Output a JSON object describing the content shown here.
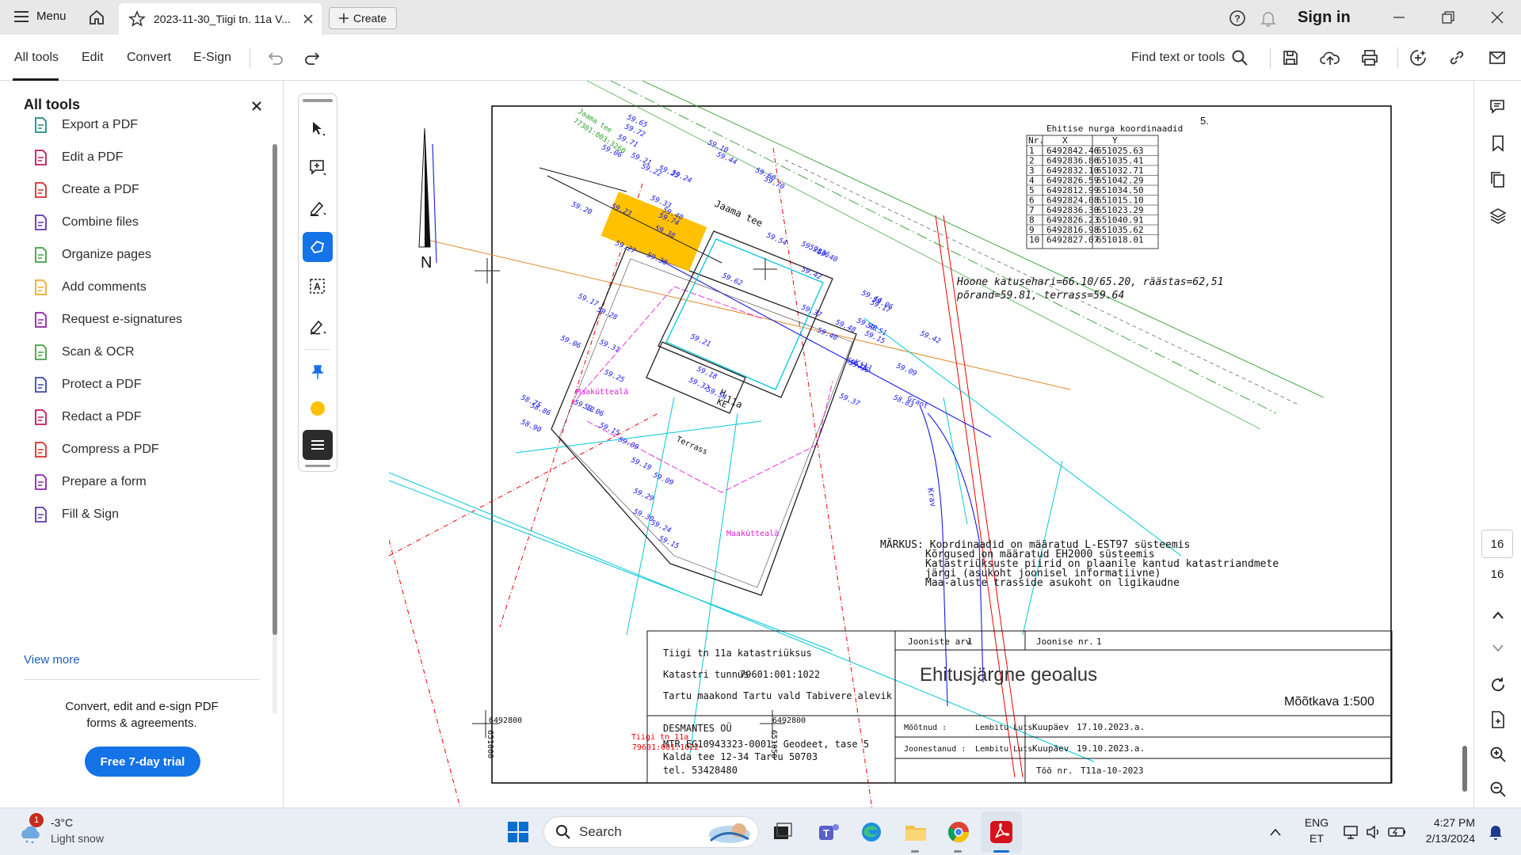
{
  "titlebar": {
    "menu_label": "Menu",
    "doc_tab_title": "2023-11-30_Tiigi tn. 11a V...",
    "create_label": "Create",
    "sign_in": "Sign in"
  },
  "toolbar": {
    "tabs": [
      "All tools",
      "Edit",
      "Convert",
      "E-Sign"
    ],
    "find_label": "Find text or tools"
  },
  "left_panel": {
    "title": "All tools",
    "items": [
      {
        "label": "Export a PDF",
        "icon": "export-pdf-icon",
        "color": "#1f8a8a"
      },
      {
        "label": "Edit a PDF",
        "icon": "edit-pdf-icon",
        "color": "#c2185b"
      },
      {
        "label": "Create a PDF",
        "icon": "create-pdf-icon",
        "color": "#d32f2f"
      },
      {
        "label": "Combine files",
        "icon": "combine-files-icon",
        "color": "#5e35b1"
      },
      {
        "label": "Organize pages",
        "icon": "organize-pages-icon",
        "color": "#43a047"
      },
      {
        "label": "Add comments",
        "icon": "add-comments-icon",
        "color": "#f9a825"
      },
      {
        "label": "Request e-signatures",
        "icon": "request-esign-icon",
        "color": "#8e24aa"
      },
      {
        "label": "Scan & OCR",
        "icon": "scan-ocr-icon",
        "color": "#43a047"
      },
      {
        "label": "Protect a PDF",
        "icon": "protect-pdf-icon",
        "color": "#3949ab"
      },
      {
        "label": "Redact a PDF",
        "icon": "redact-pdf-icon",
        "color": "#c2185b"
      },
      {
        "label": "Compress a PDF",
        "icon": "compress-pdf-icon",
        "color": "#d32f2f"
      },
      {
        "label": "Prepare a form",
        "icon": "prepare-form-icon",
        "color": "#8e24aa"
      },
      {
        "label": "Fill & Sign",
        "icon": "fill-sign-icon",
        "color": "#5e35b1"
      }
    ],
    "view_more": "View more",
    "promo_text_1": "Convert, edit and e-sign PDF",
    "promo_text_2": "forms & agreements.",
    "trial_button": "Free 7-day trial"
  },
  "drawing": {
    "page_number": "5.",
    "north": "N",
    "coord_table": {
      "title": "Ehitise nurga koordinaadid",
      "headers": [
        "Nr.",
        "X",
        "Y"
      ],
      "rows": [
        [
          "1",
          "6492842.46",
          "651025.63"
        ],
        [
          "2",
          "6492836.86",
          "651035.41"
        ],
        [
          "3",
          "6492832.10",
          "651032.71"
        ],
        [
          "4",
          "6492826.59",
          "651042.29"
        ],
        [
          "5",
          "6492812.99",
          "651034.50"
        ],
        [
          "6",
          "6492824.08",
          "651015.10"
        ],
        [
          "7",
          "6492836.30",
          "651023.29"
        ],
        [
          "8",
          "6492826.23",
          "651040.91"
        ],
        [
          "9",
          "6492816.98",
          "651035.62"
        ],
        [
          "10",
          "6492827.07",
          "651018.01"
        ]
      ]
    },
    "roof_note_1": "Hoone katusehari=66.10/65.20, räästas=62,51",
    "roof_note_2": "põrand=59.81, terrass=59.64",
    "markus": [
      "MÄRKUS: Koordinaadid on määratud L-EST97 süsteemis",
      "Kõrgused on määratud EH2000 süsteemis",
      "Katastriüksuste piirid on plaanile kantud katastriandmete",
      "järgi (asukoht joonisel informatiivne)",
      "Maa-aluste trasside asukoht on ligikaudne"
    ],
    "labels": {
      "jaama_tee": "Jaama tee",
      "jaama_tee_small": "Jaama tee",
      "jaama_tee_code": "77301:003:3260",
      "maakutteala": "Maaküttealã",
      "maakutteala2": "Maaküttealä",
      "terrass": "Terrass",
      "tiigi_tn": "Tiigi tn 11a",
      "tiigi_code": "79601:001:1022",
      "grid_x_left": "6492800",
      "grid_y_left": "651000",
      "grid_x_right": "6492800",
      "grid_y_right": "651050",
      "house_11a": "11a",
      "house_ke": "KE",
      "house_h": "H",
      "kill": "Kill",
      "krav": "Krav",
      "grant": "Grant"
    },
    "elevations": [
      "59.65",
      "59.72",
      "59.71",
      "59.06",
      "59.21",
      "59.22",
      "59.25",
      "59.24",
      "59.33",
      "59.40",
      "59.38",
      "59.23",
      "59.20",
      "59.27",
      "59.38",
      "59.17",
      "59.28",
      "59.31",
      "59.06",
      "59.25",
      "59.12",
      "59.06",
      "59.15",
      "59.09",
      "59.19",
      "59.09",
      "59.29",
      "59.30",
      "59.24",
      "59.15",
      "59.10",
      "59.44",
      "59.68",
      "59.70",
      "59.62",
      "59.54",
      "59.28",
      "59.36",
      "59.40",
      "59.42",
      "59.37",
      "59.40",
      "59.48",
      "59.44",
      "59.51",
      "59.40",
      "59.15",
      "59.23",
      "59.36",
      "59.42",
      "59.17",
      "59.06",
      "59.09",
      "58.83",
      "59.74",
      "58.75",
      "58.86",
      "58.90",
      "59.21",
      "59.18",
      "59.32",
      "59.54",
      "59.37"
    ],
    "title_block": {
      "parcel": "Tiigi tn 11a katastriüksus",
      "cadastral_label": "Katastri tunnus",
      "cadastral_value": "79601:001:1022",
      "location": "Tartu maakond Tartu vald Tabivere alevik",
      "company": "DESMANTES OÜ",
      "mtr": "MTR EG10943323-0001; Geodeet, tase 5",
      "address": "Kalda tee 12-34 Tartu 50703",
      "tel": "tel. 53428480",
      "sheets_label": "Jooniste arv",
      "sheets_value": "1",
      "sheet_no_label": "Joonise nr.",
      "sheet_no_value": "1",
      "drawing_title": "Ehitusjärgne geoalus",
      "scale": "Mõõtkava 1:500",
      "measured_label": "Mõõtnud :",
      "measured_by": "Lembitu Luts",
      "measured_date_label": "Kuupäev",
      "measured_date": "17.10.2023.a.",
      "drawn_label": "Joonestanud :",
      "drawn_by": "Lembitu Luts",
      "drawn_date_label": "Kuupäev",
      "drawn_date": "19.10.2023.a.",
      "job_label": "Töö nr.",
      "job_value": "T11a-10-2023"
    }
  },
  "right_rail": {
    "page_current": "16",
    "page_total": "16"
  },
  "taskbar": {
    "weather_badge": "1",
    "temperature": "-3°C",
    "weather": "Light snow",
    "search_placeholder": "Search",
    "lang_1": "ENG",
    "lang_2": "ET",
    "time": "4:27 PM",
    "date": "2/13/2024"
  },
  "colors": {
    "accent": "#1473e6",
    "trial_button": "#1473e6",
    "selected_tool": "#1473e6",
    "building_fill": "#ffc000"
  }
}
